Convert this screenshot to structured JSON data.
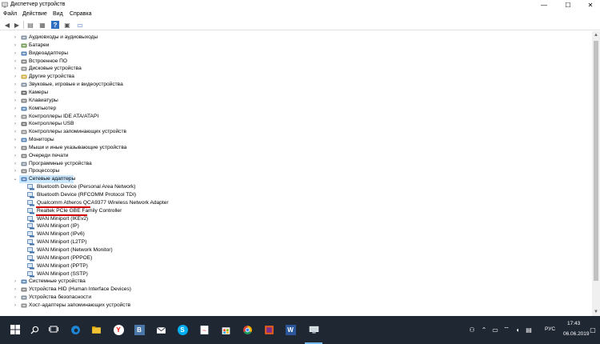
{
  "window": {
    "title": "Диспетчер устройств",
    "controls": {
      "minimize": "—",
      "maximize": "☐",
      "close": "✕"
    }
  },
  "menu": {
    "items": [
      "Файл",
      "Действие",
      "Вид",
      "Справка"
    ]
  },
  "toolbar": {
    "buttons": [
      {
        "icon": "back-arrow-icon",
        "glyph": "◀"
      },
      {
        "icon": "forward-arrow-icon",
        "glyph": "▶"
      },
      {
        "icon": "properties-icon",
        "glyph": "▤"
      },
      {
        "icon": "list-view-icon",
        "glyph": "▦"
      },
      {
        "icon": "help-icon",
        "glyph": "?"
      },
      {
        "icon": "device-view-icon",
        "glyph": "▣"
      },
      {
        "icon": "monitor-icon",
        "glyph": "▭"
      }
    ]
  },
  "tree": {
    "categories_before": [
      {
        "label": "Аудиовходы и аудиовыходы",
        "icon": "speaker-icon",
        "color": "#6b7b8c"
      },
      {
        "label": "Батареи",
        "icon": "battery-icon",
        "color": "#5a8a3a"
      },
      {
        "label": "Видеоадаптеры",
        "icon": "display-adapter-icon",
        "color": "#3b6ea8"
      },
      {
        "label": "Встроенное ПО",
        "icon": "firmware-icon",
        "color": "#6b6b6b"
      },
      {
        "label": "Дисковые устройства",
        "icon": "disk-icon",
        "color": "#7a7a7a"
      },
      {
        "label": "Другие устройства",
        "icon": "unknown-device-icon",
        "color": "#c8a020"
      },
      {
        "label": "Звуковые, игровые и видеоустройства",
        "icon": "sound-icon",
        "color": "#6b7b8c"
      },
      {
        "label": "Камеры",
        "icon": "camera-icon",
        "color": "#444444"
      },
      {
        "label": "Клавиатуры",
        "icon": "keyboard-icon",
        "color": "#6b6b6b"
      },
      {
        "label": "Компьютер",
        "icon": "computer-icon",
        "color": "#3b6ea8"
      },
      {
        "label": "Контроллеры IDE ATA/ATAPI",
        "icon": "ide-controller-icon",
        "color": "#7a7a7a"
      },
      {
        "label": "Контроллеры USB",
        "icon": "usb-icon",
        "color": "#555555"
      },
      {
        "label": "Контроллеры запоминающих устройств",
        "icon": "storage-controller-icon",
        "color": "#7a7a7a"
      },
      {
        "label": "Мониторы",
        "icon": "monitor-icon",
        "color": "#3b6ea8"
      },
      {
        "label": "Мыши и иные указывающие устройства",
        "icon": "mouse-icon",
        "color": "#6b6b6b"
      },
      {
        "label": "Очереди печати",
        "icon": "printer-icon",
        "color": "#6b6b6b"
      },
      {
        "label": "Программные устройства",
        "icon": "software-device-icon",
        "color": "#6b7b8c"
      },
      {
        "label": "Процессоры",
        "icon": "processor-icon",
        "color": "#6b6b6b"
      }
    ],
    "expanded_category": {
      "label": "Сетевые адаптеры",
      "icon": "network-adapter-icon",
      "color": "#3b6ea8"
    },
    "network_adapters": [
      "Bluetooth Device (Personal Area Network)",
      "Bluetooth Device (RFCOMM Protocol TDI)",
      "Qualcomm Atheros QCA9377 Wireless Network Adapter",
      "Realtek PCIe GBE Family Controller",
      "WAN Miniport (IKEv2)",
      "WAN Miniport (IP)",
      "WAN Miniport (IPv6)",
      "WAN Miniport (L2TP)",
      "WAN Miniport (Network Monitor)",
      "WAN Miniport (PPPOE)",
      "WAN Miniport (PPTP)",
      "WAN Miniport (SSTP)"
    ],
    "categories_after": [
      {
        "label": "Системные устройства",
        "icon": "system-device-icon",
        "color": "#3b6ea8"
      },
      {
        "label": "Устройства HID (Human Interface Devices)",
        "icon": "hid-icon",
        "color": "#6b6b6b"
      },
      {
        "label": "Устройства безопасности",
        "icon": "security-device-icon",
        "color": "#6b7b8c"
      },
      {
        "label": "Хост-адаптеры запоминающих устройств",
        "icon": "storage-host-icon",
        "color": "#7a7a7a"
      }
    ]
  },
  "taskbar": {
    "apps": [
      {
        "name": "start-icon"
      },
      {
        "name": "search-icon"
      },
      {
        "name": "task-view-icon"
      },
      {
        "name": "edge-icon"
      },
      {
        "name": "file-explorer-icon"
      },
      {
        "name": "yandex-browser-icon",
        "glyph": "Y"
      },
      {
        "name": "vk-icon",
        "glyph": "B"
      },
      {
        "name": "mail-icon"
      },
      {
        "name": "skype-icon",
        "glyph": "S"
      },
      {
        "name": "pdf-reader-icon"
      },
      {
        "name": "store-icon"
      },
      {
        "name": "chrome-icon"
      },
      {
        "name": "photos-icon"
      },
      {
        "name": "word-icon",
        "glyph": "W"
      },
      {
        "name": "device-manager-taskbar-icon"
      }
    ],
    "tray": {
      "language": "РУС",
      "time": "17:43",
      "date": "06.06.2019"
    }
  },
  "colors": {
    "taskbar_bg": "#1f2733",
    "selection": "#cce8ff",
    "highlight_underline": "#d40000",
    "network_icon": "#3b6ea8"
  }
}
